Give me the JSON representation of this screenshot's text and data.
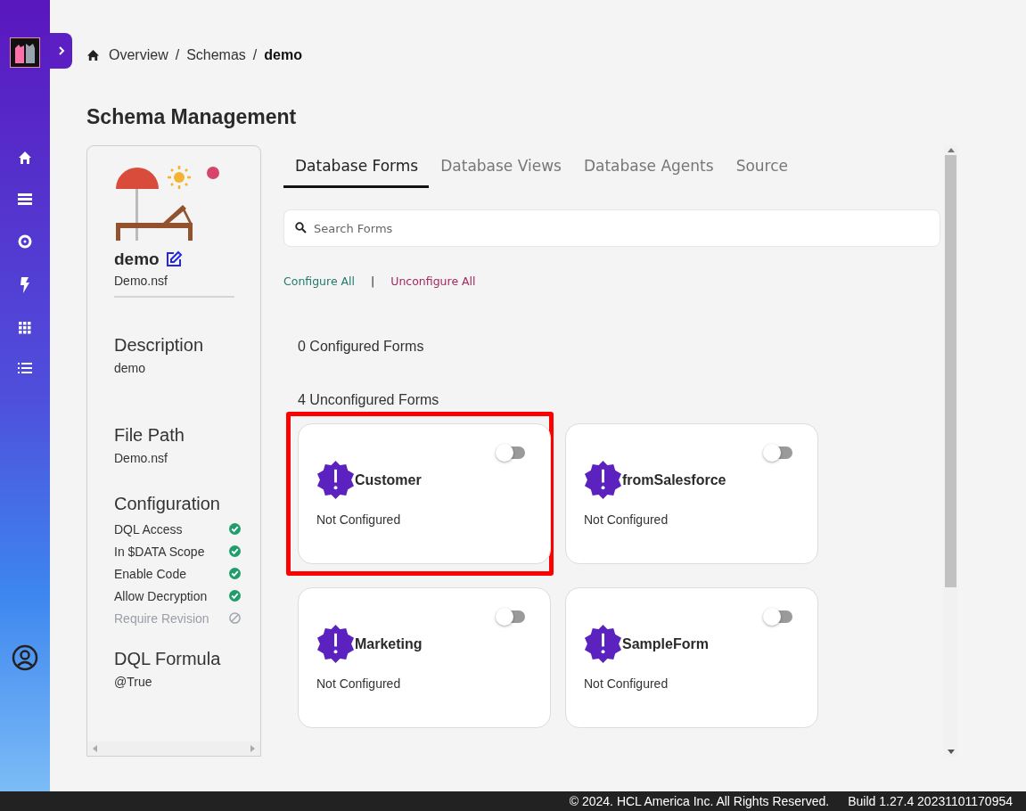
{
  "breadcrumb": [
    {
      "label": "Overview",
      "current": false
    },
    {
      "separator": "/",
      "label": "Schemas",
      "current": false
    },
    {
      "separator": "/",
      "label": "demo",
      "current": true
    }
  ],
  "title": "Schema Management",
  "schema": {
    "name": "demo",
    "file": "Demo.nsf",
    "sections": [
      {
        "heading": "Description",
        "value": "demo"
      },
      {
        "heading": "File Path",
        "value": "Demo.nsf"
      }
    ],
    "configuration": {
      "heading": "Configuration",
      "items": [
        {
          "label": "DQL Access",
          "enabled": true
        },
        {
          "label": "In $DATA Scope",
          "enabled": true
        },
        {
          "label": "Enable Code",
          "enabled": true
        },
        {
          "label": "Allow Decryption",
          "enabled": true
        },
        {
          "label": "Require Revision",
          "enabled": false
        }
      ]
    },
    "formula": {
      "heading": "DQL Formula",
      "value": "@True"
    }
  },
  "tabs": [
    {
      "label": "Database Forms",
      "selected": true
    },
    {
      "label": "Database Views",
      "selected": false
    },
    {
      "label": "Database Agents",
      "selected": false
    },
    {
      "label": "Source",
      "selected": false
    }
  ],
  "search": {
    "placeholder": "Search Forms"
  },
  "actions": {
    "configure": "Configure All",
    "separator": "|",
    "unconfigure": "Unconfigure All"
  },
  "configured_heading": "0 Configured Forms",
  "unconfigured_heading": "4 Unconfigured Forms",
  "forms": [
    {
      "name": "Customer",
      "status": "Not Configured",
      "on": false,
      "highlighted": true
    },
    {
      "name": "fromSalesforce",
      "status": "Not Configured",
      "on": false,
      "highlighted": false
    },
    {
      "name": "Marketing",
      "status": "Not Configured",
      "on": false,
      "highlighted": false
    },
    {
      "name": "SampleForm",
      "status": "Not Configured",
      "on": false,
      "highlighted": false
    }
  ],
  "footer": {
    "copyright": "© 2024. HCL America Inc. All Rights Reserved.",
    "build": "Build 1.27.4 20231101170954"
  }
}
